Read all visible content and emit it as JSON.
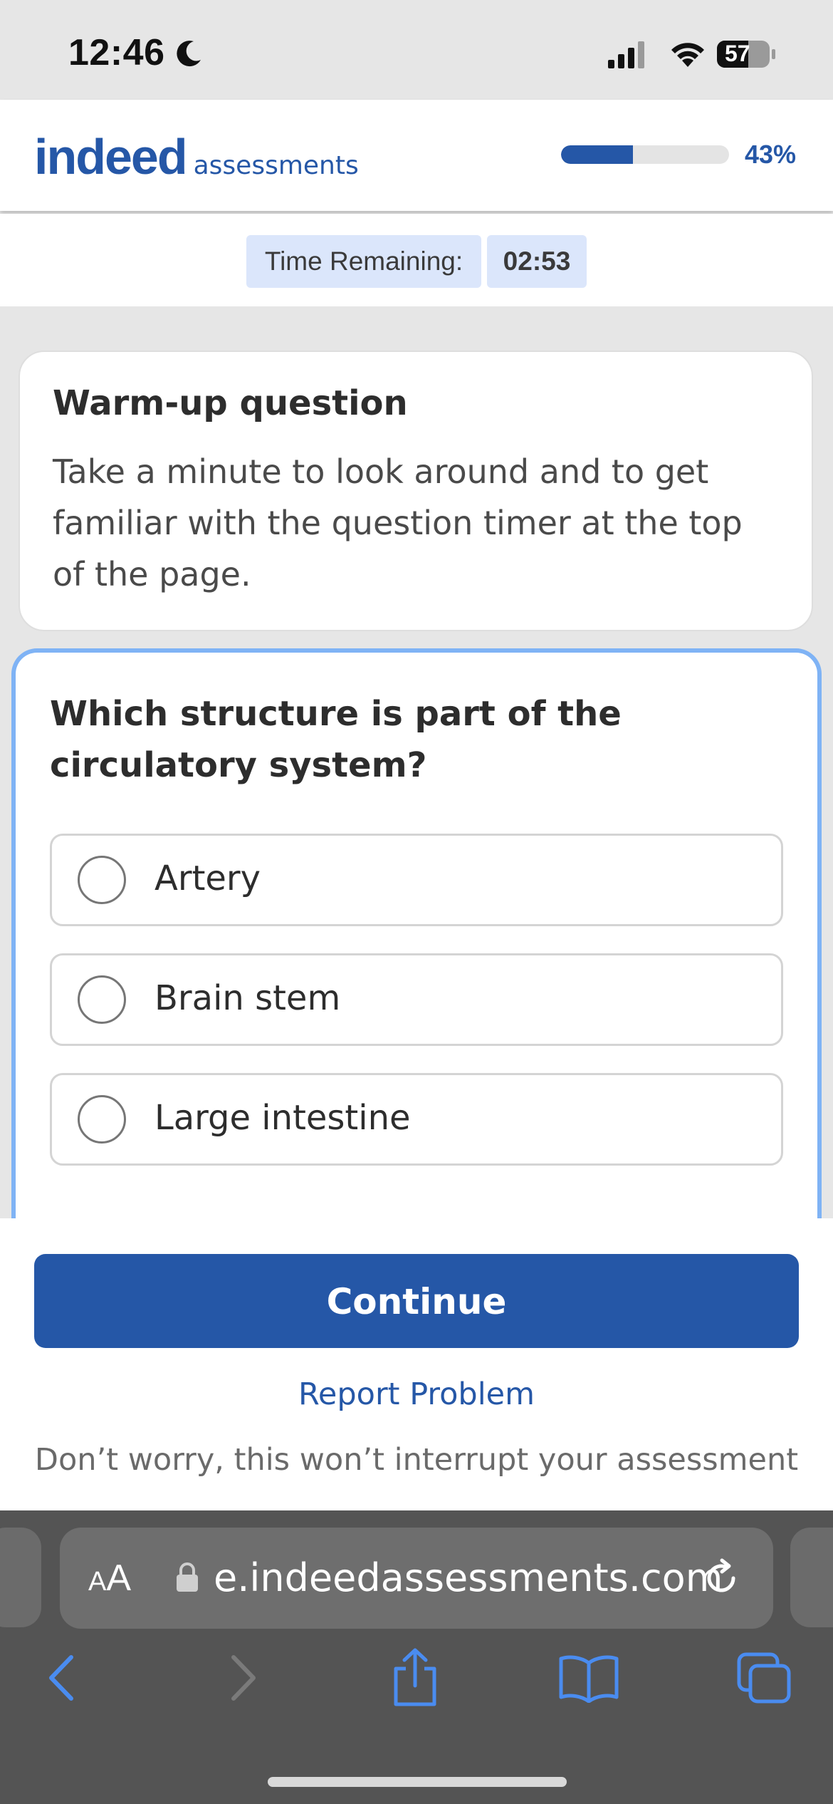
{
  "status_bar": {
    "time": "12:46",
    "battery": "57",
    "icons": [
      "moon-icon",
      "signal-icon",
      "wifi-icon",
      "battery-icon"
    ]
  },
  "header": {
    "logo_main": "indeed",
    "logo_sub": "assessments",
    "progress_percent_text": "43%",
    "progress_fraction": 0.43
  },
  "timer": {
    "label": "Time Remaining:",
    "value": "02:53"
  },
  "warmup": {
    "title": "Warm-up question",
    "text": "Take a minute to look around and to get familiar with the question timer at the top of the page."
  },
  "question": {
    "text": "Which structure is part of the circulatory system?",
    "options": [
      {
        "label": "Artery",
        "selected": false
      },
      {
        "label": "Brain stem",
        "selected": false
      },
      {
        "label": "Large intestine",
        "selected": false
      }
    ]
  },
  "actions": {
    "continue_label": "Continue",
    "report_label": "Report Problem",
    "reassure_text": "Don’t worry, this won’t interrupt your assessment"
  },
  "browser": {
    "aa_small": "A",
    "aa_large": "A",
    "url": "e.indeedassessments.com",
    "toolbar_icons": [
      "back-icon",
      "forward-icon",
      "share-icon",
      "bookmarks-icon",
      "tabs-icon"
    ]
  },
  "colors": {
    "brand_blue": "#2557a7",
    "focus_border": "#7fb3f5",
    "timer_bg": "#dbe6fb"
  }
}
